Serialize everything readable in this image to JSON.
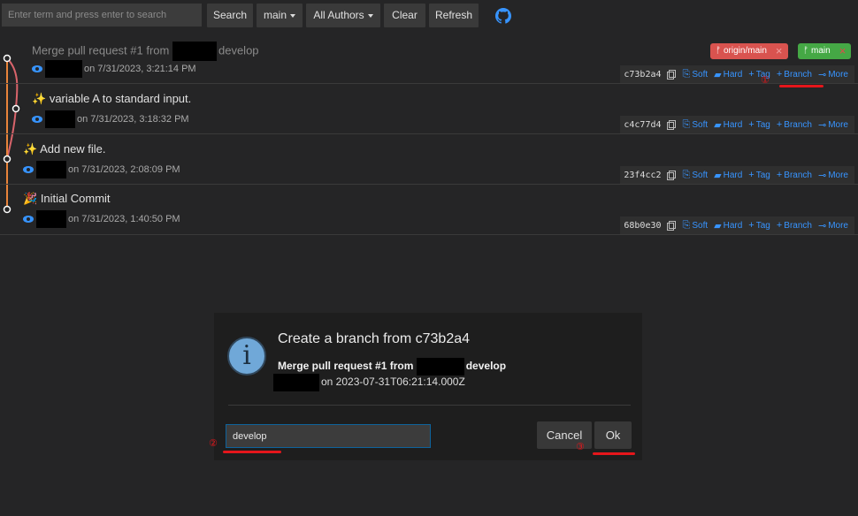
{
  "toolbar": {
    "search_placeholder": "Enter term and press enter to search",
    "search_label": "Search",
    "branch_label": "main",
    "authors_label": "All Authors",
    "clear_label": "Clear",
    "refresh_label": "Refresh",
    "github_icon": "github-icon"
  },
  "refs": {
    "remote": {
      "label": "origin/main",
      "color": "#d9534f",
      "close": "×"
    },
    "local": {
      "label": "main",
      "color": "#45a845",
      "close": "×"
    }
  },
  "actions": {
    "soft": "Soft",
    "hard": "Hard",
    "tag": "Tag",
    "branch": "Branch",
    "more": "More"
  },
  "commits": [
    {
      "message": "Merge pull request #1 from",
      "message_suffix": "develop",
      "emoji": "",
      "date": "on 7/31/2023, 3:21:14 PM",
      "hash": "c73b2a4"
    },
    {
      "message": "variable A to standard input.",
      "emoji": "✨",
      "date": "on 7/31/2023, 3:18:32 PM",
      "hash": "c4c77d4"
    },
    {
      "message": "Add new file.",
      "emoji": "✨",
      "date": "on 7/31/2023, 2:08:09 PM",
      "hash": "23f4cc2"
    },
    {
      "message": "Initial Commit",
      "emoji": "🎉",
      "date": "on 7/31/2023, 1:40:50 PM",
      "hash": "68b0e30"
    }
  ],
  "dialog": {
    "title": "Create a branch from c73b2a4",
    "message_prefix": "Merge pull request #1 from",
    "message_suffix": "develop",
    "author_line": "on 2023-07-31T06:21:14.000Z",
    "input_value": "develop",
    "cancel_label": "Cancel",
    "ok_label": "Ok",
    "icon": "info-icon"
  },
  "annotations": {
    "one": "①",
    "two": "②",
    "three": "③",
    "color": "#e5161b"
  },
  "colors": {
    "accent": "#3794ff",
    "graph": "#e8833a",
    "graph_branch": "#d9646b",
    "background": "#252526"
  }
}
